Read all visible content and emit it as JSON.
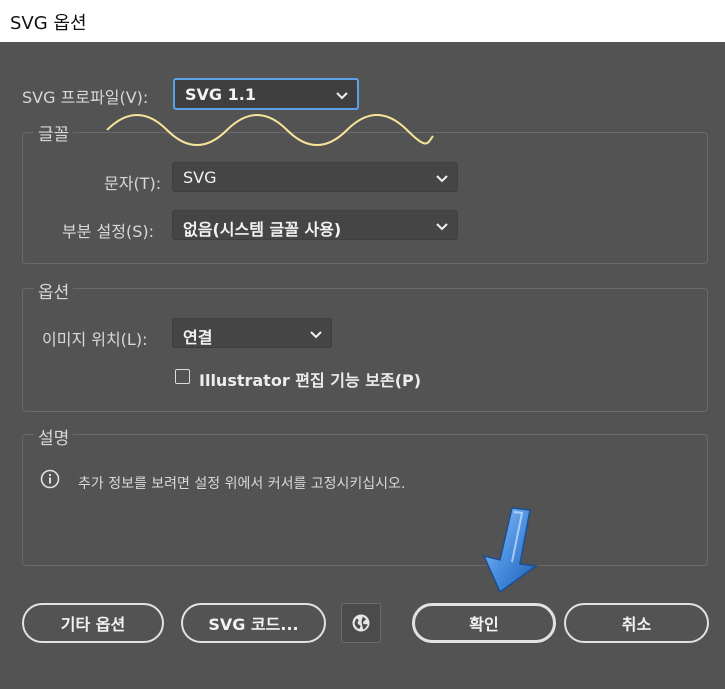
{
  "window": {
    "title": "SVG 옵션"
  },
  "profile": {
    "label": "SVG 프로파일(V):",
    "value": "SVG 1.1"
  },
  "font_group": {
    "title": "글꼴",
    "type_label": "문자(T):",
    "type_value": "SVG",
    "subset_label": "부분 설정(S):",
    "subset_value": "없음(시스템 글꼴 사용)"
  },
  "options_group": {
    "title": "옵션",
    "image_label": "이미지 위치(L):",
    "image_value": "연결",
    "preserve_label": "Illustrator 편집 기능 보존(P)",
    "preserve_checked": false
  },
  "description_group": {
    "title": "설명",
    "text": "추가 정보를 보려면 설정 위에서 커서를 고정시키십시오."
  },
  "buttons": {
    "more_options": "기타 옵션",
    "svg_code": "SVG 코드...",
    "ok": "확인",
    "cancel": "취소"
  },
  "colors": {
    "background": "#535353",
    "focus": "#5aa1ea",
    "squiggle": "#f5e49a",
    "arrow": "#4a8fe0"
  }
}
